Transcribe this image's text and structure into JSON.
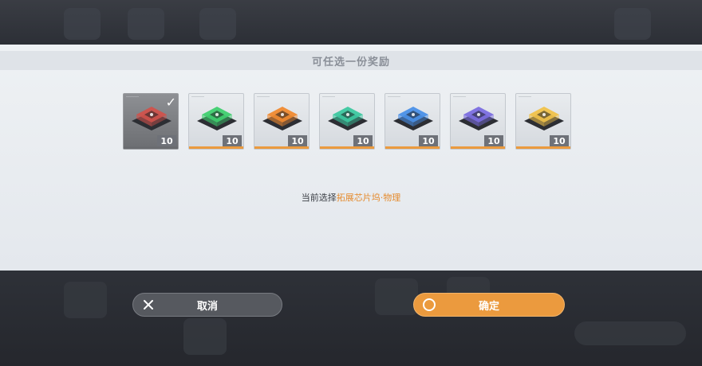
{
  "dialog": {
    "title": "可任选一份奖励",
    "status_prefix": "当前选择",
    "status_selection": "拓展芯片坞·物理"
  },
  "rewards": [
    {
      "name": "physical",
      "quantity": "10",
      "color": "#d0524c",
      "selected": true
    },
    {
      "name": "green",
      "quantity": "10",
      "color": "#3fcf6f",
      "selected": false
    },
    {
      "name": "orange",
      "quantity": "10",
      "color": "#f08a30",
      "selected": false
    },
    {
      "name": "teal",
      "quantity": "10",
      "color": "#3cc8a0",
      "selected": false
    },
    {
      "name": "blue",
      "quantity": "10",
      "color": "#4a90e8",
      "selected": false
    },
    {
      "name": "purple",
      "quantity": "10",
      "color": "#7b6ee0",
      "selected": false
    },
    {
      "name": "yellow",
      "quantity": "10",
      "color": "#f0c24a",
      "selected": false
    }
  ],
  "buttons": {
    "cancel_label": "取消",
    "confirm_label": "确定"
  },
  "colors": {
    "accent": "#eb9a3e",
    "highlight_text": "#e58b2f"
  }
}
